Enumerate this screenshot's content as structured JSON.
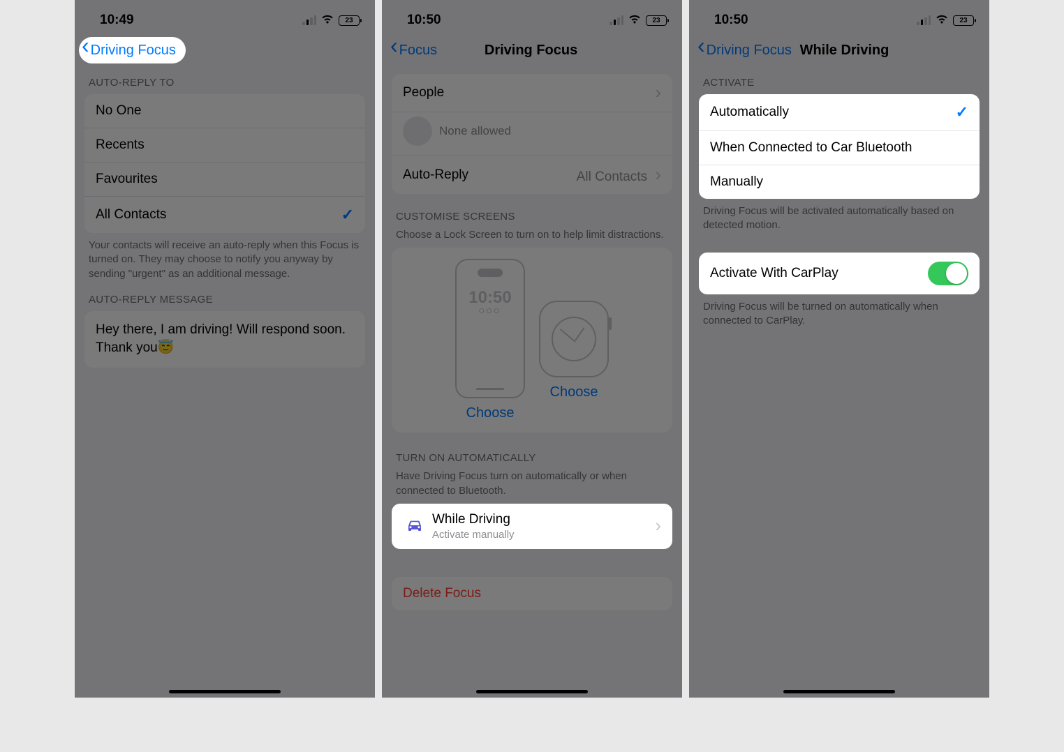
{
  "screen1": {
    "time": "10:49",
    "battery": "23",
    "back_label": "Driving Focus",
    "section_auto_reply_to": "AUTO-REPLY TO",
    "options": {
      "no_one": "No One",
      "recents": "Recents",
      "favourites": "Favourites",
      "all_contacts": "All Contacts"
    },
    "footer_auto_reply": "Your contacts will receive an auto-reply when this Focus is turned on. They may choose to notify you anyway by sending \"urgent\" as an additional message.",
    "section_message": "AUTO-REPLY MESSAGE",
    "message_text": "Hey there, I am driving! Will respond soon. Thank you😇"
  },
  "screen2": {
    "time": "10:50",
    "battery": "23",
    "back_label": "Focus",
    "title": "Driving Focus",
    "people_label": "People",
    "none_allowed": "None allowed",
    "auto_reply_label": "Auto-Reply",
    "auto_reply_value": "All Contacts",
    "customise_header": "CUSTOMISE SCREENS",
    "customise_footer": "Choose a Lock Screen to turn on to help limit distractions.",
    "mock_time": "10:50",
    "mock_date": "OOO",
    "choose_label": "Choose",
    "auto_header": "TURN ON AUTOMATICALLY",
    "auto_footer": "Have Driving Focus turn on automatically or when connected to Bluetooth.",
    "while_driving_label": "While Driving",
    "while_driving_sub": "Activate manually",
    "delete_label": "Delete Focus"
  },
  "screen3": {
    "time": "10:50",
    "battery": "23",
    "back_label": "Driving Focus",
    "title": "While Driving",
    "activate_header": "ACTIVATE",
    "opt_auto": "Automatically",
    "opt_bt": "When Connected to Car Bluetooth",
    "opt_manual": "Manually",
    "activate_footer": "Driving Focus will be activated automatically based on detected motion.",
    "carplay_label": "Activate With CarPlay",
    "carplay_footer": "Driving Focus will be turned on automatically when connected to CarPlay."
  }
}
